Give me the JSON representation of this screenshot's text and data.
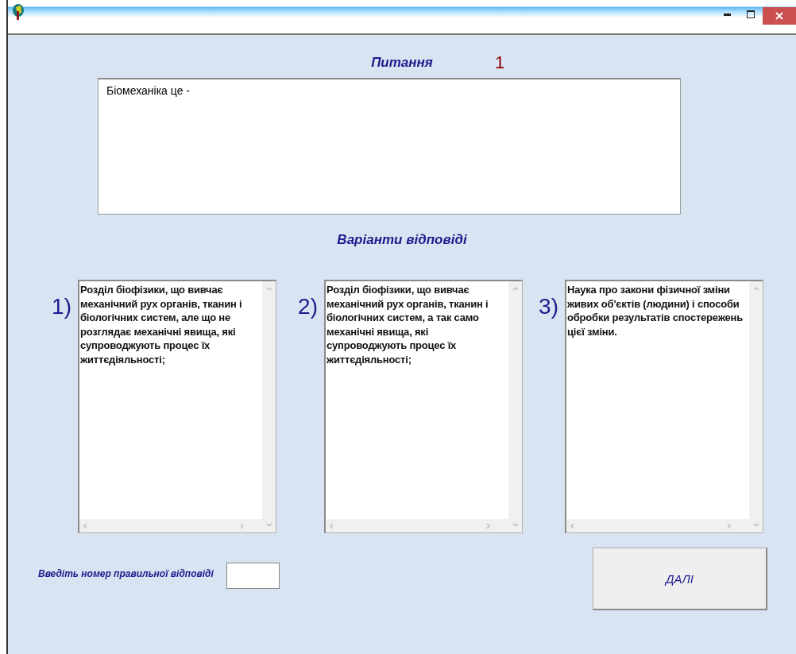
{
  "question": {
    "heading": "Питання",
    "number": "1",
    "text": "Біомеханіка це -"
  },
  "answers_heading": "Варіанти відповіді",
  "answers": [
    {
      "number": "1)",
      "text": "Розділ біофізики, що вивчає механічний рух органів, тканин і біологічних систем, але що не розглядає механічні явища, які супроводжують процес їх життєдіяльності;"
    },
    {
      "number": "2)",
      "text": "Розділ біофізики, що вивчає механічний рух органів, тканин і біологічних систем, а так само механічні явища, які супроводжують процес їх життєдіяльності;"
    },
    {
      "number": "3)",
      "text": "Наука про закони фізичної зміни живих об'єктів (людини) і способи обробки результатів спостережень цієї зміни."
    }
  ],
  "prompt_label": "Введіть номер правильної відповіді",
  "next_button": "ДАЛІ"
}
